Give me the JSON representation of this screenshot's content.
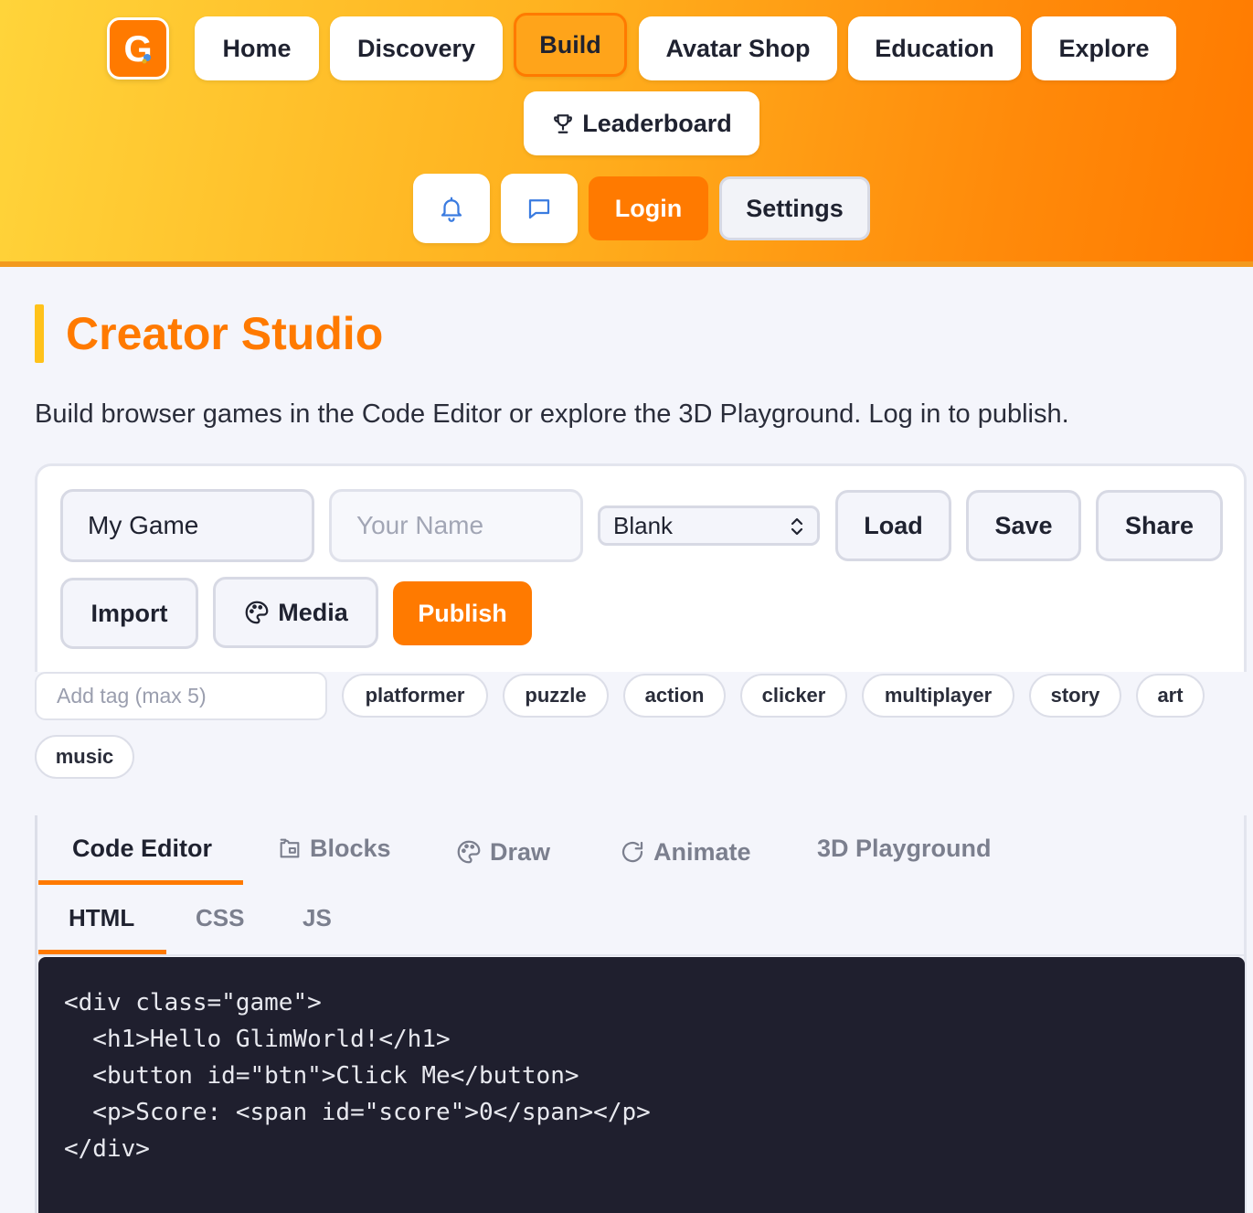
{
  "header": {
    "logo_letter": "G",
    "nav": [
      {
        "label": "Home"
      },
      {
        "label": "Discovery"
      },
      {
        "label": "Build",
        "active": true
      },
      {
        "label": "Avatar Shop"
      },
      {
        "label": "Education"
      },
      {
        "label": "Explore"
      },
      {
        "label": "Leaderboard",
        "icon": "trophy-icon"
      }
    ],
    "notifications_icon": "bell-icon",
    "messages_icon": "chat-icon",
    "login_label": "Login",
    "settings_label": "Settings"
  },
  "page": {
    "title": "Creator Studio",
    "subtitle": "Build browser games in the Code Editor or explore the 3D Playground. Log in to publish."
  },
  "form": {
    "game_name_value": "My Game",
    "author_placeholder": "Your Name",
    "template_selected": "Blank",
    "load_label": "Load",
    "save_label": "Save",
    "share_label": "Share",
    "import_label": "Import",
    "media_label": "Media",
    "publish_label": "Publish"
  },
  "tags": {
    "placeholder": "Add tag (max 5)",
    "suggestions": [
      "platformer",
      "puzzle",
      "action",
      "clicker",
      "multiplayer",
      "story",
      "art",
      "music"
    ]
  },
  "tabs": [
    {
      "label": "Code Editor",
      "active": true
    },
    {
      "label": "Blocks",
      "icon": "blocks-icon"
    },
    {
      "label": "Draw",
      "icon": "palette-icon"
    },
    {
      "label": "Animate",
      "icon": "refresh-icon"
    },
    {
      "label": "3D Playground"
    }
  ],
  "subtabs": [
    {
      "label": "HTML",
      "active": true
    },
    {
      "label": "CSS"
    },
    {
      "label": "JS"
    }
  ],
  "code": {
    "content": "<div class=\"game\">\n  <h1>Hello GlimWorld!</h1>\n  <button id=\"btn\">Click Me</button>\n  <p>Score: <span id=\"score\">0</span></p>\n</div>"
  },
  "colors": {
    "accent": "#ff7a00",
    "accent_yellow": "#ffc21a",
    "code_bg": "#1f1f2e"
  }
}
